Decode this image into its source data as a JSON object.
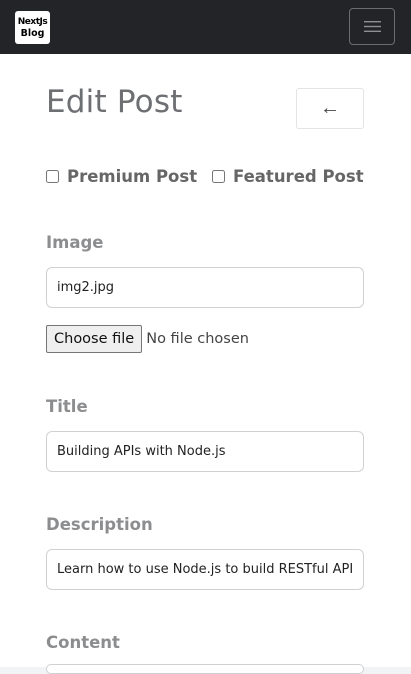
{
  "navbar": {
    "logo_line1": "NextJs",
    "logo_line2": "Blog",
    "menu_icon": "hamburger-menu-icon"
  },
  "page": {
    "title": "Edit Post",
    "back_symbol": "←",
    "back_icon": "arrow-left-icon"
  },
  "options": {
    "premium_label": "Premium Post",
    "premium_checked": false,
    "featured_label": "Featured Post",
    "featured_checked": false
  },
  "form": {
    "image_label": "Image",
    "image_value": "img2.jpg",
    "file_button": "Choose file",
    "file_status": "No file chosen",
    "title_label": "Title",
    "title_value": "Building APIs with Node.js",
    "description_label": "Description",
    "description_value": "Learn how to use Node.js to build RESTful APIs",
    "content_label": "Content"
  },
  "colors": {
    "navbar_bg": "#222428",
    "page_bg": "#ffffff"
  }
}
